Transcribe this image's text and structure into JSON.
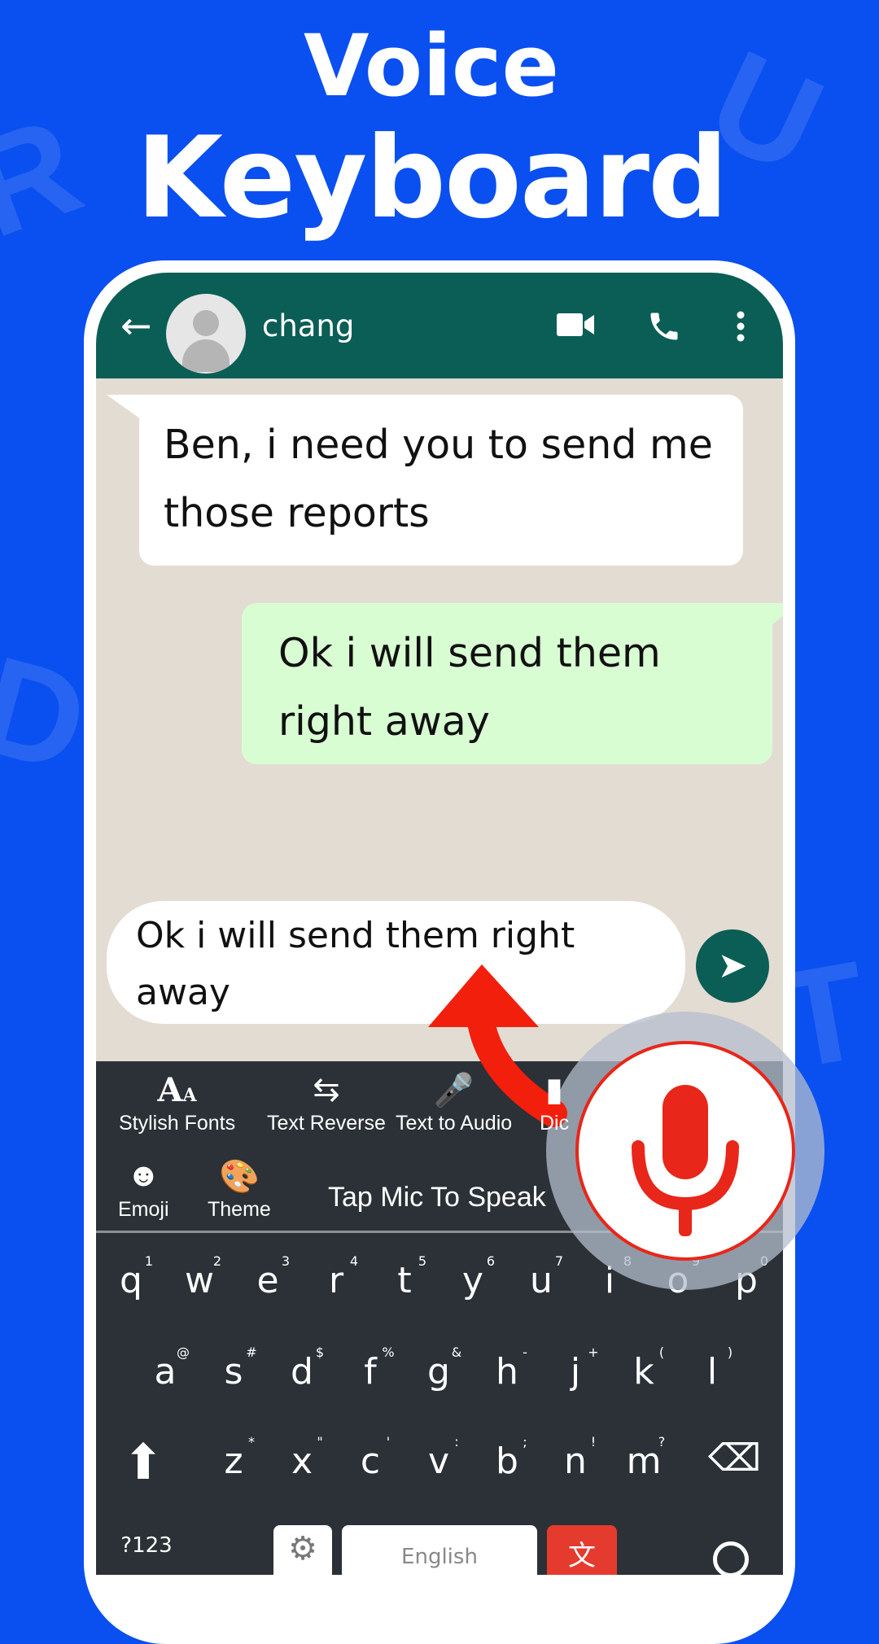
{
  "headline": {
    "line1": "Voice",
    "line2": "Keyboard"
  },
  "colors": {
    "background": "#0a4ff0",
    "header": "#0b5e55",
    "outgoing_bubble": "#d9fdd3",
    "keyboard": "#2b3136",
    "accent_red": "#e8261a"
  },
  "chat_header": {
    "contact_name": "chang",
    "icons": [
      "back-arrow-icon",
      "avatar-icon",
      "video-call-icon",
      "phone-icon",
      "more-vert-icon"
    ]
  },
  "messages": [
    {
      "direction": "incoming",
      "text": "Ben, i need you to send me those reports"
    },
    {
      "direction": "outgoing",
      "text": "Ok i will send them right away"
    }
  ],
  "composer": {
    "value": "Ok i will send them right away"
  },
  "toolbar": {
    "items": [
      {
        "label": "Stylish Fonts",
        "icon": "font-icon"
      },
      {
        "label": "Text Reverse",
        "icon": "text-reverse-icon"
      },
      {
        "label": "Text to Audio",
        "icon": "mic-icon"
      },
      {
        "label": "Dic",
        "icon": "dictionary-icon"
      },
      {
        "label": "Emoji",
        "icon": "emoji-icon"
      },
      {
        "label": "Theme",
        "icon": "theme-icon"
      }
    ],
    "hint": "Tap Mic To Speak"
  },
  "keyboard": {
    "row1": [
      "q",
      "w",
      "e",
      "r",
      "t",
      "y",
      "u",
      "i",
      "o",
      "p"
    ],
    "row1_sup": [
      "1",
      "2",
      "3",
      "4",
      "5",
      "6",
      "7",
      "8",
      "9",
      "0"
    ],
    "row2": [
      "a",
      "s",
      "d",
      "f",
      "g",
      "h",
      "j",
      "k",
      "l"
    ],
    "row2_sup": [
      "@",
      "#",
      "$",
      "%",
      "&",
      "-",
      "+",
      "(",
      ")"
    ],
    "row3": [
      "z",
      "x",
      "c",
      "v",
      "b",
      "n",
      "m"
    ],
    "row3_sup": [
      "*",
      "\"",
      "'",
      ":",
      ";",
      "!",
      "?"
    ],
    "symbols_key": "?123",
    "space_label": "English"
  }
}
